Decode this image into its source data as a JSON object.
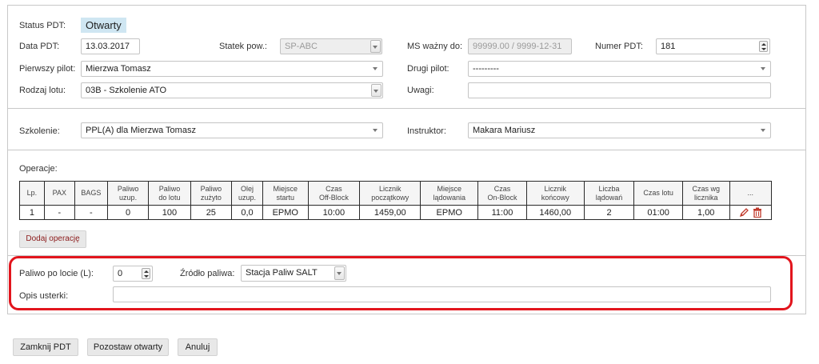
{
  "form": {
    "status_label": "Status PDT:",
    "status_value": "Otwarty",
    "date_label": "Data PDT:",
    "date_value": "13.03.2017",
    "aircraft_label": "Statek pow.:",
    "aircraft_value": "SP-ABC",
    "ms_label": "MS ważny do:",
    "ms_value": "99999.00 / 9999-12-31",
    "pdt_number_label": "Numer PDT:",
    "pdt_number_value": "181",
    "pilot1_label": "Pierwszy pilot:",
    "pilot1_value": "Mierzwa Tomasz",
    "pilot2_label": "Drugi pilot:",
    "pilot2_value": "---------",
    "flight_type_label": "Rodzaj lotu:",
    "flight_type_value": "03B - Szkolenie ATO",
    "remarks_label": "Uwagi:",
    "remarks_value": ""
  },
  "training": {
    "training_label": "Szkolenie:",
    "training_value": "PPL(A) dla Mierzwa Tomasz",
    "instructor_label": "Instruktor:",
    "instructor_value": "Makara Mariusz"
  },
  "operations": {
    "title": "Operacje:",
    "headers": [
      [
        "Lp."
      ],
      [
        "PAX"
      ],
      [
        "BAGS"
      ],
      [
        "Paliwo",
        "uzup."
      ],
      [
        "Paliwo",
        "do lotu"
      ],
      [
        "Paliwo",
        "zużyto"
      ],
      [
        "Olej",
        "uzup."
      ],
      [
        "Miejsce",
        "startu"
      ],
      [
        "Czas",
        "Off-Block"
      ],
      [
        "Licznik",
        "początkowy"
      ],
      [
        "Miejsce",
        "lądowania"
      ],
      [
        "Czas",
        "On-Block"
      ],
      [
        "Licznik",
        "końcowy"
      ],
      [
        "Liczba",
        "lądowań"
      ],
      [
        "Czas lotu"
      ],
      [
        "Czas wg",
        "licznika"
      ],
      [
        "..."
      ]
    ],
    "rows": [
      [
        "1",
        "-",
        "-",
        "0",
        "100",
        "25",
        "0,0",
        "EPMO",
        "10:00",
        "1459,00",
        "EPMO",
        "11:00",
        "1460,00",
        "2",
        "01:00",
        "1,00"
      ]
    ],
    "add_button": "Dodaj operację"
  },
  "fuel": {
    "fuel_after_label": "Paliwo po locie (L):",
    "fuel_after_value": "0",
    "fuel_source_label": "Źródło paliwa:",
    "fuel_source_value": "Stacja Paliw SALT",
    "defect_label": "Opis usterki:",
    "defect_value": ""
  },
  "actions": {
    "close": "Zamknij PDT",
    "leave_open": "Pozostaw otwarty",
    "cancel": "Anuluj"
  },
  "colors": {
    "status_bg": "#cfe6f2",
    "highlight": "#e2151d",
    "action_icons": "#c0392b"
  },
  "icons": {
    "edit": "pencil-icon",
    "delete": "trash-icon"
  }
}
